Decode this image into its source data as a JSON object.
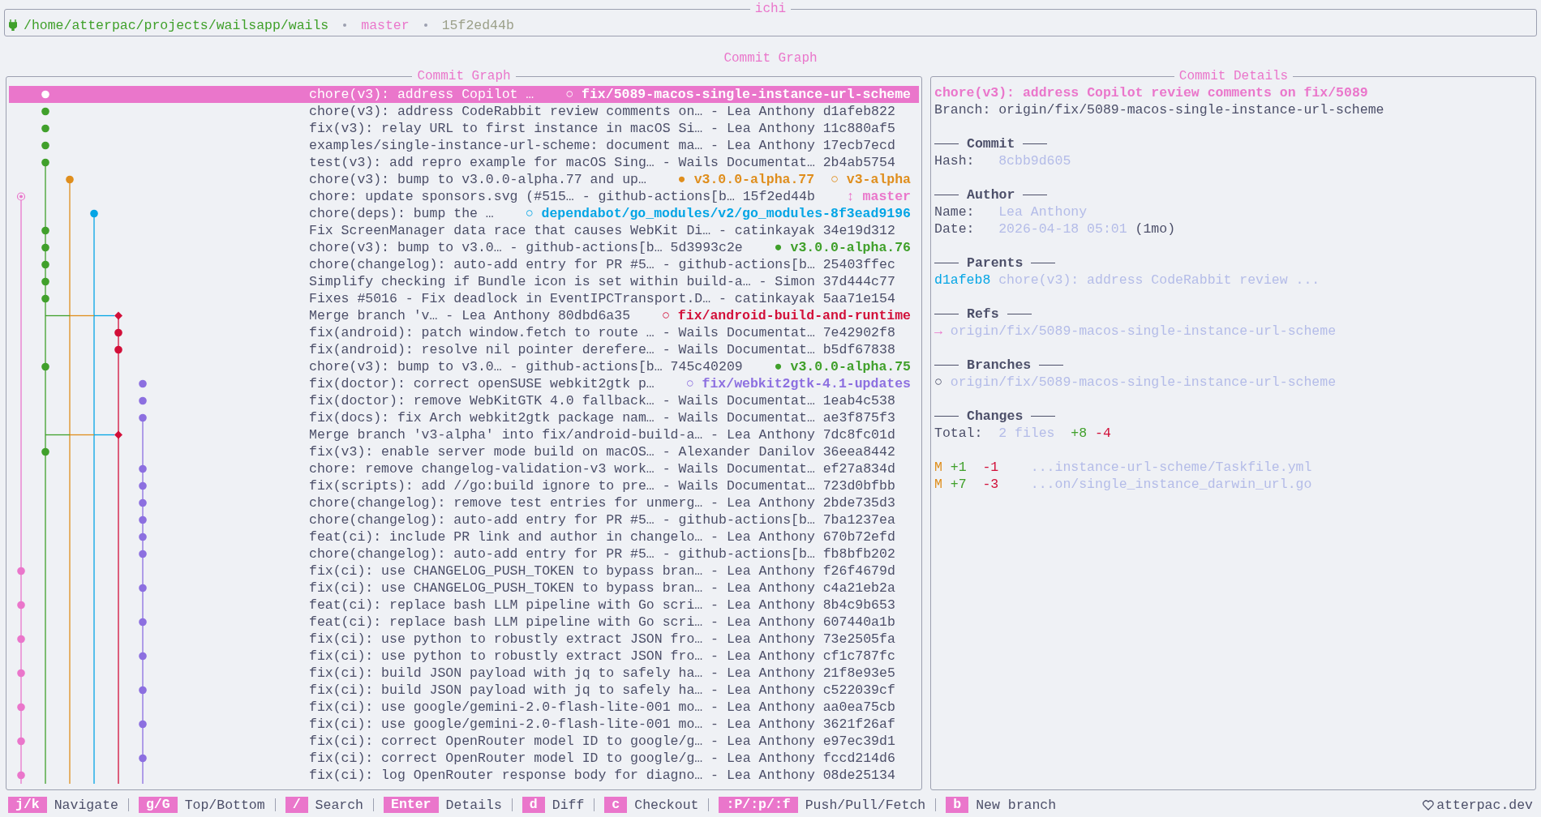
{
  "app_title": "ichi",
  "header": {
    "path": "/home/atterpac/projects/wailsapp/wails",
    "branch": "master",
    "head": "15f2ed44b"
  },
  "view_title": "Commit Graph",
  "graph_panel": {
    "title": "Commit Graph",
    "commits": [
      {
        "summary": "chore(v3): address Copilot …",
        "selected": true,
        "refs": [
          {
            "marker": "○",
            "name": "fix/5089-macos-single-instance-url-scheme",
            "color": "#ea76cb"
          }
        ]
      },
      {
        "summary": "chore(v3): address CodeRabbit review comments on… - Lea Anthony d1afeb822",
        "selected": false
      },
      {
        "summary": "fix(v3): relay URL to first instance in macOS Si… - Lea Anthony 11c880af5",
        "selected": false
      },
      {
        "summary": "examples/single-instance-url-scheme: document ma… - Lea Anthony 17ecb7ecd",
        "selected": false
      },
      {
        "summary": "test(v3): add repro example for macOS Sing… - Wails Documentat… 2b4ab5754",
        "selected": false
      },
      {
        "summary": "chore(v3): bump to v3.0.0-alpha.77 and up…",
        "selected": false,
        "refs": [
          {
            "marker": "●",
            "name": "v3.0.0-alpha.77",
            "color": "#df8e1d"
          },
          {
            "marker": "○",
            "name": "v3-alpha",
            "color": "#df8e1d"
          }
        ]
      },
      {
        "summary": "chore: update sponsors.svg (#515… - github-actions[b… 15f2ed44b",
        "selected": false,
        "refs": [
          {
            "marker": "↕",
            "name": "master",
            "color": "#ea76cb"
          }
        ]
      },
      {
        "summary": "chore(deps): bump the …",
        "selected": false,
        "refs": [
          {
            "marker": "○",
            "name": "dependabot/go_modules/v2/go_modules-8f3ead9196",
            "color": "#04a5e5"
          }
        ]
      },
      {
        "summary": "Fix ScreenManager data race that causes WebKit Di… - catinkayak 34e19d312",
        "selected": false
      },
      {
        "summary": "chore(v3): bump to v3.0… - github-actions[b… 5d3993c2e",
        "selected": false,
        "refs": [
          {
            "marker": "●",
            "name": "v3.0.0-alpha.76",
            "color": "#40a02b"
          }
        ]
      },
      {
        "summary": "chore(changelog): auto-add entry for PR #5… - github-actions[b… 25403ffec",
        "selected": false
      },
      {
        "summary": "Simplify checking if Bundle icon is set within build-a… - Simon 37d444c77",
        "selected": false
      },
      {
        "summary": "Fixes #5016 - Fix deadlock in EventIPCTransport.D… - catinkayak 5aa71e154",
        "selected": false
      },
      {
        "summary": "Merge branch 'v… - Lea Anthony 80dbd6a35",
        "selected": false,
        "refs": [
          {
            "marker": "○",
            "name": "fix/android-build-and-runtime",
            "color": "#d20f39"
          }
        ]
      },
      {
        "summary": "fix(android): patch window.fetch to route … - Wails Documentat… 7e42902f8",
        "selected": false
      },
      {
        "summary": "fix(android): resolve nil pointer derefere… - Wails Documentat… b5df67838",
        "selected": false
      },
      {
        "summary": "chore(v3): bump to v3.0… - github-actions[b… 745c40209",
        "selected": false,
        "refs": [
          {
            "marker": "●",
            "name": "v3.0.0-alpha.75",
            "color": "#40a02b"
          }
        ]
      },
      {
        "summary": "fix(doctor): correct openSUSE webkit2gtk p…",
        "selected": false,
        "refs": [
          {
            "marker": "○",
            "name": "fix/webkit2gtk-4.1-updates",
            "color": "#8c6fe0"
          }
        ]
      },
      {
        "summary": "fix(doctor): remove WebKitGTK 4.0 fallback… - Wails Documentat… 1eab4c538",
        "selected": false
      },
      {
        "summary": "fix(docs): fix Arch webkit2gtk package nam… - Wails Documentat… ae3f875f3",
        "selected": false
      },
      {
        "summary": "Merge branch 'v3-alpha' into fix/android-build-a… - Lea Anthony 7dc8fc01d",
        "selected": false
      },
      {
        "summary": "fix(v3): enable server mode build on macOS… - Alexander Danilov 36eea8442",
        "selected": false
      },
      {
        "summary": "chore: remove changelog-validation-v3 work… - Wails Documentat… ef27a834d",
        "selected": false
      },
      {
        "summary": "fix(scripts): add //go:build ignore to pre… - Wails Documentat… 723d0bfbb",
        "selected": false
      },
      {
        "summary": "chore(changelog): remove test entries for unmerg… - Lea Anthony 2bde735d3",
        "selected": false
      },
      {
        "summary": "chore(changelog): auto-add entry for PR #5… - github-actions[b… 7ba1237ea",
        "selected": false
      },
      {
        "summary": "feat(ci): include PR link and author in changelo… - Lea Anthony 670b72efd",
        "selected": false
      },
      {
        "summary": "chore(changelog): auto-add entry for PR #5… - github-actions[b… fb8bfb202",
        "selected": false
      },
      {
        "summary": "fix(ci): use CHANGELOG_PUSH_TOKEN to bypass bran… - Lea Anthony f26f4679d",
        "selected": false
      },
      {
        "summary": "fix(ci): use CHANGELOG_PUSH_TOKEN to bypass bran… - Lea Anthony c4a21eb2a",
        "selected": false
      },
      {
        "summary": "feat(ci): replace bash LLM pipeline with Go scri… - Lea Anthony 8b4c9b653",
        "selected": false
      },
      {
        "summary": "feat(ci): replace bash LLM pipeline with Go scri… - Lea Anthony 607440a1b",
        "selected": false
      },
      {
        "summary": "fix(ci): use python to robustly extract JSON fro… - Lea Anthony 73e2505fa",
        "selected": false
      },
      {
        "summary": "fix(ci): use python to robustly extract JSON fro… - Lea Anthony cf1c787fc",
        "selected": false
      },
      {
        "summary": "fix(ci): build JSON payload with jq to safely ha… - Lea Anthony 21f8e93e5",
        "selected": false
      },
      {
        "summary": "fix(ci): build JSON payload with jq to safely ha… - Lea Anthony c522039cf",
        "selected": false
      },
      {
        "summary": "fix(ci): use google/gemini-2.0-flash-lite-001 mo… - Lea Anthony aa0ea75cb",
        "selected": false
      },
      {
        "summary": "fix(ci): use google/gemini-2.0-flash-lite-001 mo… - Lea Anthony 3621f26af",
        "selected": false
      },
      {
        "summary": "fix(ci): correct OpenRouter model ID to google/g… - Lea Anthony e97ec39d1",
        "selected": false
      },
      {
        "summary": "fix(ci): correct OpenRouter model ID to google/g… - Lea Anthony fccd214d6",
        "selected": false
      },
      {
        "summary": "fix(ci): log OpenRouter response body for diagno… - Lea Anthony 08de25134",
        "selected": false
      }
    ]
  },
  "details_panel": {
    "title": "Commit Details",
    "commit_title": "chore(v3): address Copilot review comments on fix/5089",
    "branch": {
      "label": "Branch:",
      "value": "origin/fix/5089-macos-single-instance-url-scheme"
    },
    "commit": {
      "heading": "Commit",
      "fields": [
        {
          "label": "Hash:",
          "value": "8cbb9d605"
        }
      ]
    },
    "author": {
      "heading": "Author",
      "fields": [
        {
          "label": "Name:",
          "value": "Lea Anthony"
        },
        {
          "label": "Date:",
          "value": "2026-04-18 05:01",
          "note": "(1mo)"
        }
      ]
    },
    "parents": {
      "heading": "Parents",
      "items": [
        {
          "hash": "d1afeb8",
          "message": "chore(v3): address CodeRabbit review ..."
        }
      ]
    },
    "refs": {
      "heading": "Refs",
      "items": [
        {
          "marker": "→",
          "name": "origin/fix/5089-macos-single-instance-url-scheme"
        }
      ]
    },
    "branches": {
      "heading": "Branches",
      "items": [
        {
          "marker": "○",
          "name": "origin/fix/5089-macos-single-instance-url-scheme"
        }
      ]
    },
    "changes": {
      "heading": "Changes",
      "label": "Total:",
      "files": "2 files",
      "added": "+8",
      "removed": "-4",
      "items": [
        {
          "status": "M",
          "added": "+1",
          "removed": "-1",
          "path": "...instance-url-scheme/Taskfile.yml"
        },
        {
          "status": "M",
          "added": "+7",
          "removed": "-3",
          "path": "...on/single_instance_darwin_url.go"
        }
      ]
    }
  },
  "footer": {
    "shortcuts": [
      {
        "key": "j/k",
        "label": "Navigate"
      },
      {
        "key": "g/G",
        "label": "Top/Bottom"
      },
      {
        "key": "/",
        "label": "Search"
      },
      {
        "key": "Enter",
        "label": "Details"
      },
      {
        "key": "d",
        "label": "Diff"
      },
      {
        "key": "c",
        "label": "Checkout"
      },
      {
        "key": ":P/:p/:f",
        "label": "Push/Pull/Fetch"
      },
      {
        "key": "b",
        "label": "New branch"
      }
    ],
    "credit": "atterpac.dev"
  }
}
